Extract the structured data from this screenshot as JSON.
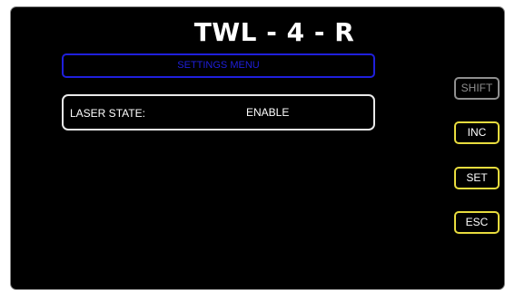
{
  "screen": {
    "title": "TWL - 4 - R"
  },
  "menu": {
    "header": "SETTINGS MENU"
  },
  "settings": [
    {
      "label": "LASER STATE:",
      "value": "ENABLE"
    }
  ],
  "buttons": {
    "shift": "SHIFT",
    "inc": "INC",
    "set": "SET",
    "esc": "ESC"
  },
  "colors": {
    "background": "#000000",
    "menu_accent": "#1f1fdc",
    "button_border": "#e8dc3e",
    "disabled": "#8f8f8f",
    "text": "#ffffff"
  }
}
